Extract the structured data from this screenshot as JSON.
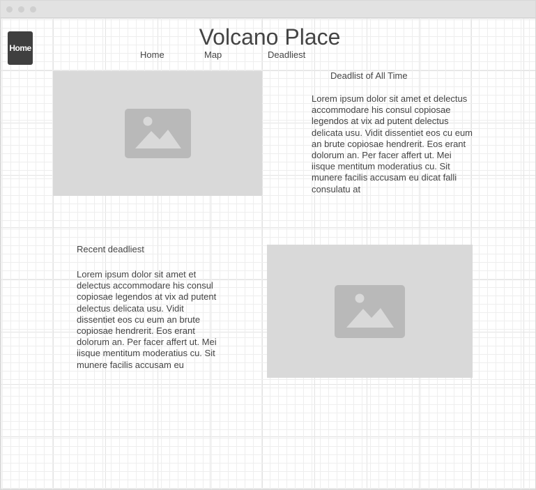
{
  "home_button": {
    "label": "Home"
  },
  "site": {
    "title": "Volcano Place"
  },
  "nav": {
    "items": [
      {
        "label": "Home"
      },
      {
        "label": "Map"
      },
      {
        "label": "Deadliest"
      }
    ]
  },
  "sections": {
    "all_time": {
      "heading": "Deadlist of All Time",
      "body": "Lorem ipsum dolor sit amet et delectus accommodare his consul copiosae legendos at vix ad putent delectus delicata usu. Vidit dissentiet eos cu eum an brute copiosae hendrerit. Eos erant dolorum an. Per facer affert ut. Mei iisque mentitum moderatius cu. Sit munere facilis accusam eu dicat falli consulatu at"
    },
    "recent": {
      "heading": "Recent deadliest",
      "body": "Lorem ipsum dolor sit amet et delectus accommodare his consul copiosae legendos at vix ad putent delectus delicata usu. Vidit dissentiet eos cu eum an brute copiosae hendrerit. Eos erant dolorum an. Per facer affert ut. Mei iisque mentitum moderatius cu. Sit munere facilis accusam eu"
    }
  },
  "icons": {
    "image_placeholder": "image-icon",
    "window_controls": "dot-icon"
  },
  "colors": {
    "placeholder_bg": "#d9d9d9",
    "placeholder_icon": "#b9b9b9",
    "home_button_bg": "#3f3f3f",
    "text": "#444444"
  }
}
